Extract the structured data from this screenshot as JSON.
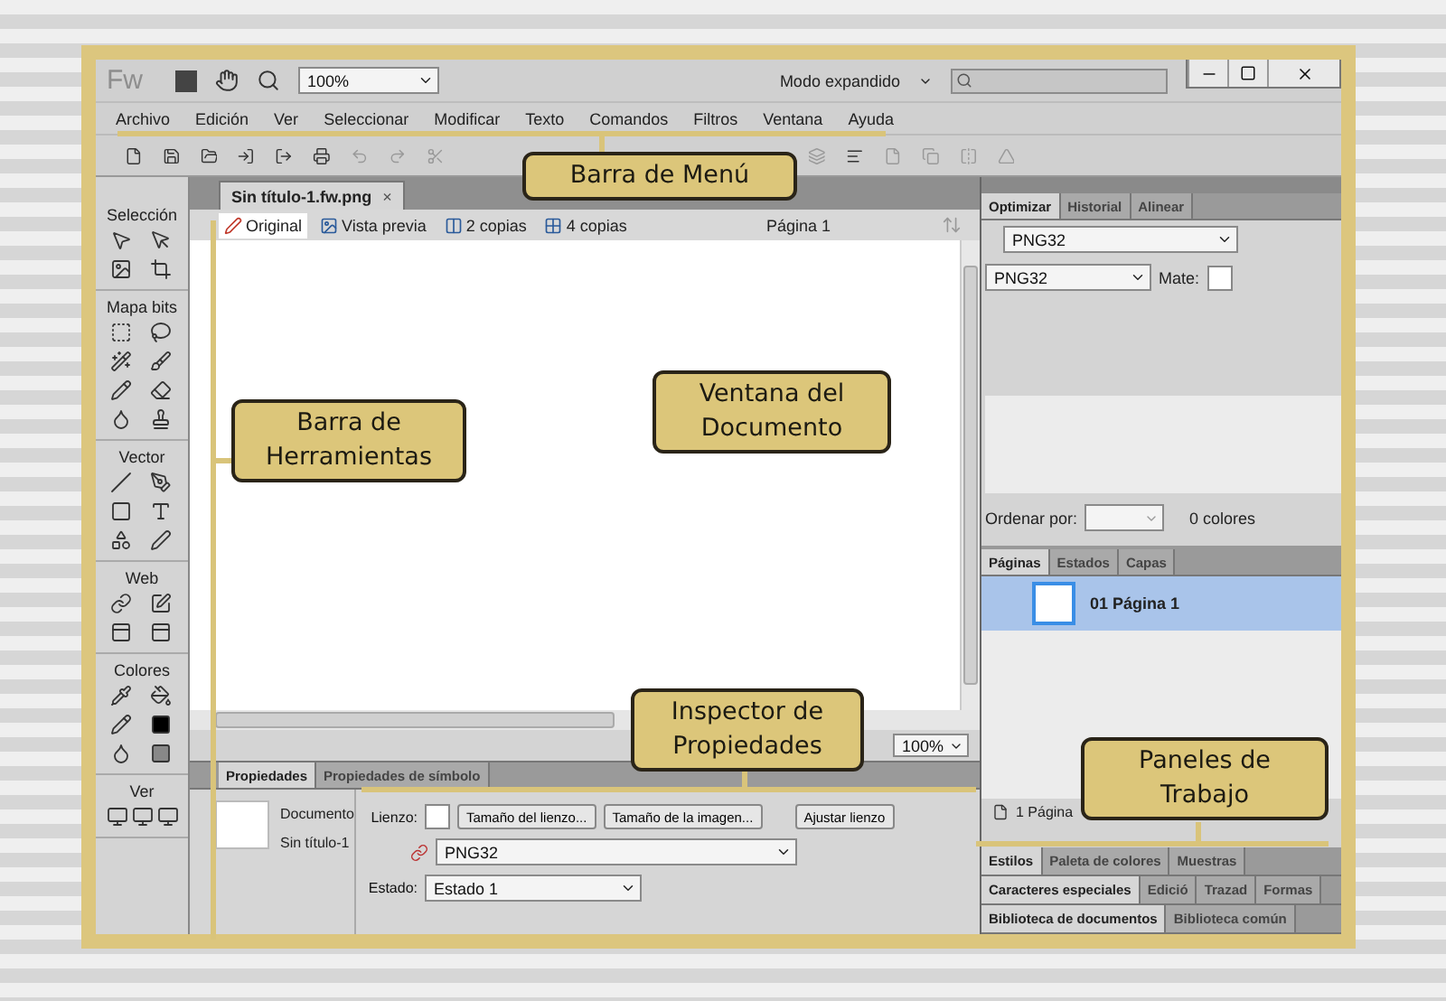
{
  "app": {
    "logo": "Fw",
    "zoom": "100%",
    "workspace": "Modo expandido"
  },
  "menu": [
    "Archivo",
    "Edición",
    "Ver",
    "Seleccionar",
    "Modificar",
    "Texto",
    "Comandos",
    "Filtros",
    "Ventana",
    "Ayuda"
  ],
  "document": {
    "tab": "Sin título-1.fw.png",
    "close": "×",
    "page": "Página 1",
    "zoom": "100%",
    "views": [
      {
        "label": "Original",
        "kind": "original",
        "selected": true
      },
      {
        "label": "Vista previa",
        "kind": "preview",
        "selected": false
      },
      {
        "label": "2 copias",
        "kind": "two",
        "selected": false
      },
      {
        "label": "4 copias",
        "kind": "four",
        "selected": false
      }
    ]
  },
  "tools": [
    "Selección",
    "Mapa bits",
    "Vector",
    "Web",
    "Colores",
    "Ver"
  ],
  "properties": {
    "tabs": [
      {
        "label": "Propiedades",
        "selected": true
      },
      {
        "label": "Propiedades de símbolo",
        "selected": false
      }
    ],
    "object_type": "Documento",
    "object_name": "Sin título-1",
    "canvas_label": "Lienzo:",
    "buttons": [
      "Tamaño del lienzo...",
      "Tamaño de la imagen...",
      "Ajustar lienzo"
    ],
    "format": "PNG32",
    "state_label": "Estado:",
    "state": "Estado 1"
  },
  "optimize": {
    "tabs": [
      {
        "label": "Optimizar",
        "selected": true
      },
      {
        "label": "Historial",
        "selected": false
      },
      {
        "label": "Alinear",
        "selected": false
      }
    ],
    "preset": "PNG32",
    "format": "PNG32",
    "matte_label": "Mate:",
    "sort_label": "Ordenar por:",
    "colors": "0 colores"
  },
  "pages": {
    "tabs": [
      {
        "label": "Páginas",
        "selected": true
      },
      {
        "label": "Estados",
        "selected": false
      },
      {
        "label": "Capas",
        "selected": false
      }
    ],
    "rows": [
      {
        "number": "01",
        "name": "Página 1",
        "selected": true
      }
    ],
    "footer": "1 Página"
  },
  "panel_groups": [
    [
      {
        "label": "Estilos",
        "selected": true
      },
      {
        "label": "Paleta de colores",
        "selected": false
      },
      {
        "label": "Muestras",
        "selected": false
      }
    ],
    [
      {
        "label": "Caracteres especiales",
        "selected": true
      },
      {
        "label": "Edició",
        "selected": false
      },
      {
        "label": "Trazad",
        "selected": false
      },
      {
        "label": "Formas",
        "selected": false
      }
    ],
    [
      {
        "label": "Biblioteca de documentos",
        "selected": true
      },
      {
        "label": "Biblioteca común",
        "selected": false
      }
    ]
  ],
  "callouts": [
    "Barra de Menú",
    "Barra de Herramientas",
    "Ventana del Documento",
    "Inspector de Propiedades",
    "Paneles de Trabajo"
  ]
}
